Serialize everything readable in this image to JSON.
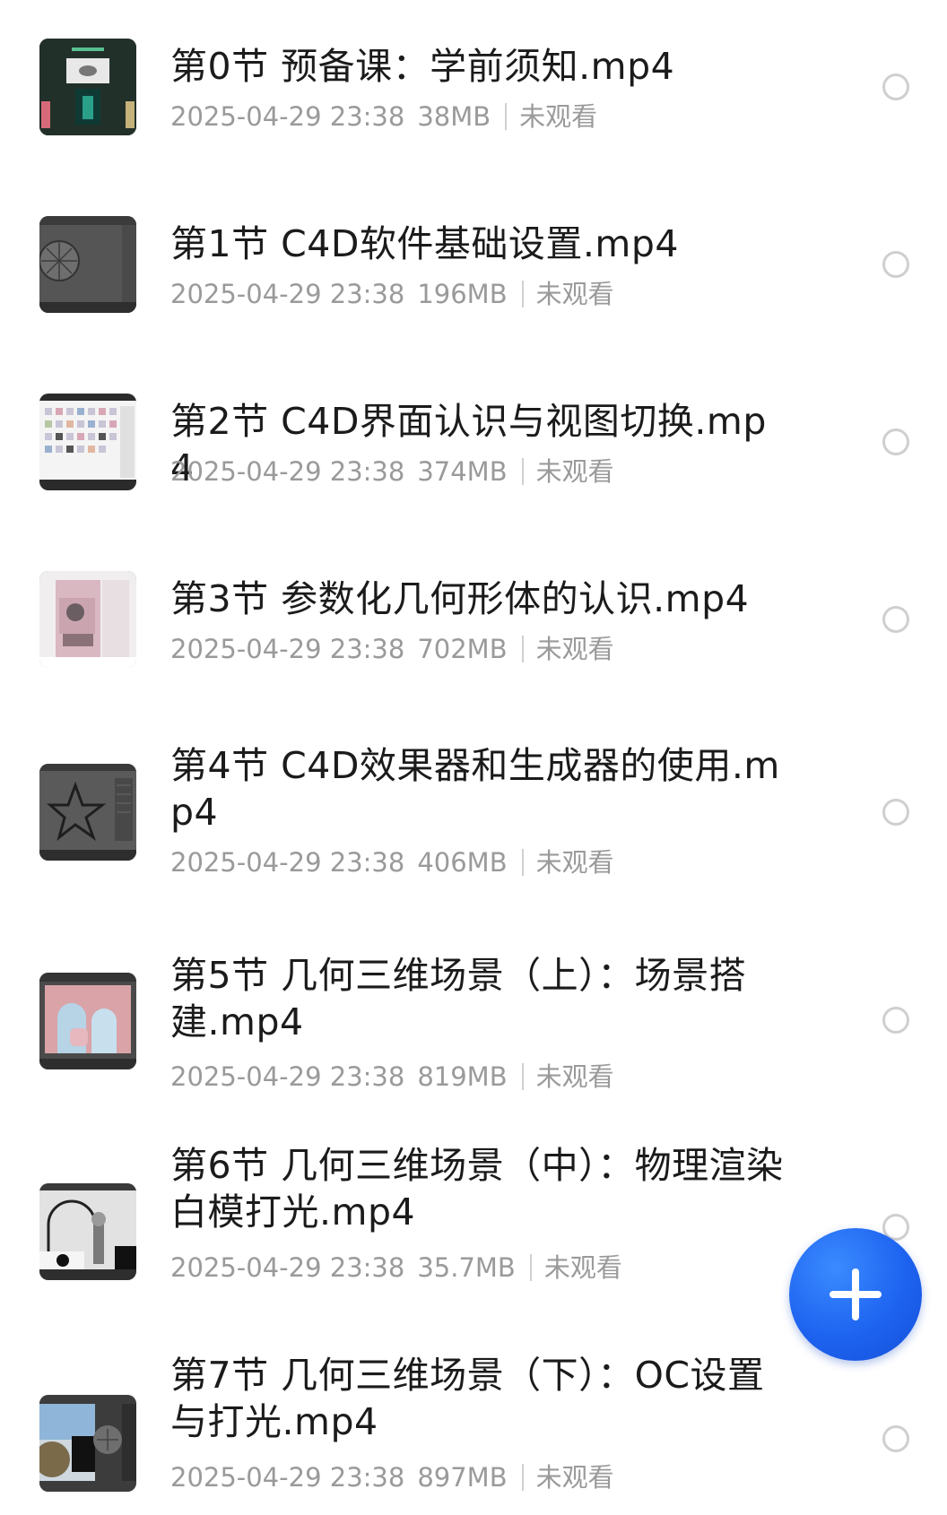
{
  "files": [
    {
      "title": "第0节 预备课：学前须知.mp4",
      "date": "2025-04-29 23:38",
      "size": "38MB",
      "status": "未观看",
      "thumb": "intro-screen"
    },
    {
      "title": "第1节 C4D软件基础设置.mp4",
      "date": "2025-04-29 23:38",
      "size": "196MB",
      "status": "未观看",
      "thumb": "sphere-viewport"
    },
    {
      "title": "第2节 C4D界面认识与视图切换.mp4",
      "date": "2025-04-29 23:38",
      "size": "374MB",
      "status": "未观看",
      "thumb": "material-grid"
    },
    {
      "title": "第3节 参数化几何形体的认识.mp4",
      "date": "2025-04-29 23:38",
      "size": "702MB",
      "status": "未观看",
      "thumb": "pink-scene"
    },
    {
      "title": "第4节 C4D效果器和生成器的使用.mp4",
      "date": "2025-04-29 23:38",
      "size": "406MB",
      "status": "未观看",
      "thumb": "star-viewport"
    },
    {
      "title": "第5节 几何三维场景（上）：场景搭建.mp4",
      "date": "2025-04-29 23:38",
      "size": "819MB",
      "status": "未观看",
      "thumb": "arch-scene"
    },
    {
      "title": "第6节 几何三维场景（中）：物理渲染白模打光.mp4",
      "date": "2025-04-29 23:38",
      "size": "35.7MB",
      "status": "未观看",
      "thumb": "white-model"
    },
    {
      "title": "第7节 几何三维场景（下）：OC设置与打光.mp4",
      "date": "2025-04-29 23:38",
      "size": "897MB",
      "status": "未观看",
      "thumb": "oc-render"
    }
  ],
  "fab": {
    "icon": "plus-icon",
    "color": "#1d63f0"
  }
}
